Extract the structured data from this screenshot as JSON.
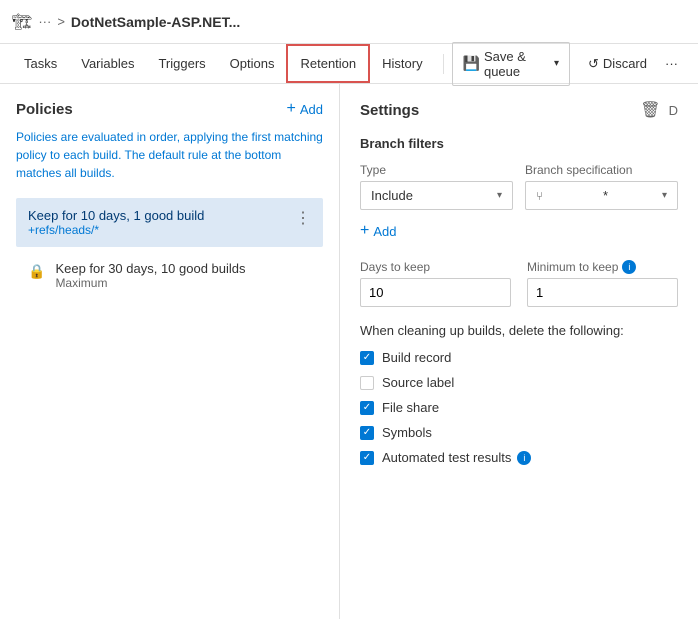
{
  "topbar": {
    "icon": "🏗",
    "dots": "···",
    "sep": ">",
    "title": "DotNetSample-ASP.NET..."
  },
  "nav": {
    "items": [
      {
        "id": "tasks",
        "label": "Tasks",
        "active": false
      },
      {
        "id": "variables",
        "label": "Variables",
        "active": false
      },
      {
        "id": "triggers",
        "label": "Triggers",
        "active": false
      },
      {
        "id": "options",
        "label": "Options",
        "active": false
      },
      {
        "id": "retention",
        "label": "Retention",
        "active": true
      },
      {
        "id": "history",
        "label": "History",
        "active": false
      }
    ],
    "save_label": "Save & queue",
    "discard_label": "Discard",
    "more": "···"
  },
  "left": {
    "title": "Policies",
    "add_label": "Add",
    "description": "Policies are evaluated in order, applying the first matching policy to each build. The default rule at the bottom matches all builds.",
    "policies": [
      {
        "id": "policy1",
        "title": "Keep for 10 days, 1 good build",
        "subtitle": "+refs/heads/*",
        "selected": true
      }
    ],
    "locked_policies": [
      {
        "id": "policy2",
        "title": "Keep for 30 days, 10 good builds",
        "subtitle": "Maximum"
      }
    ]
  },
  "right": {
    "title": "Settings",
    "section_branch": "Branch filters",
    "type_label": "Type",
    "type_value": "Include",
    "branch_label": "Branch specification",
    "branch_value": "* *",
    "add_filter_label": "Add",
    "days_label": "Days to keep",
    "days_value": "10",
    "minimum_label": "Minimum to keep",
    "minimum_value": "1",
    "delete_when_label": "When cleaning up builds, delete the following:",
    "checkboxes": [
      {
        "id": "build_record",
        "label": "Build record",
        "checked": true
      },
      {
        "id": "source_label",
        "label": "Source label",
        "checked": false
      },
      {
        "id": "file_share",
        "label": "File share",
        "checked": true
      },
      {
        "id": "symbols",
        "label": "Symbols",
        "checked": true
      },
      {
        "id": "automated_test",
        "label": "Automated test results",
        "checked": true,
        "has_info": true
      }
    ]
  }
}
